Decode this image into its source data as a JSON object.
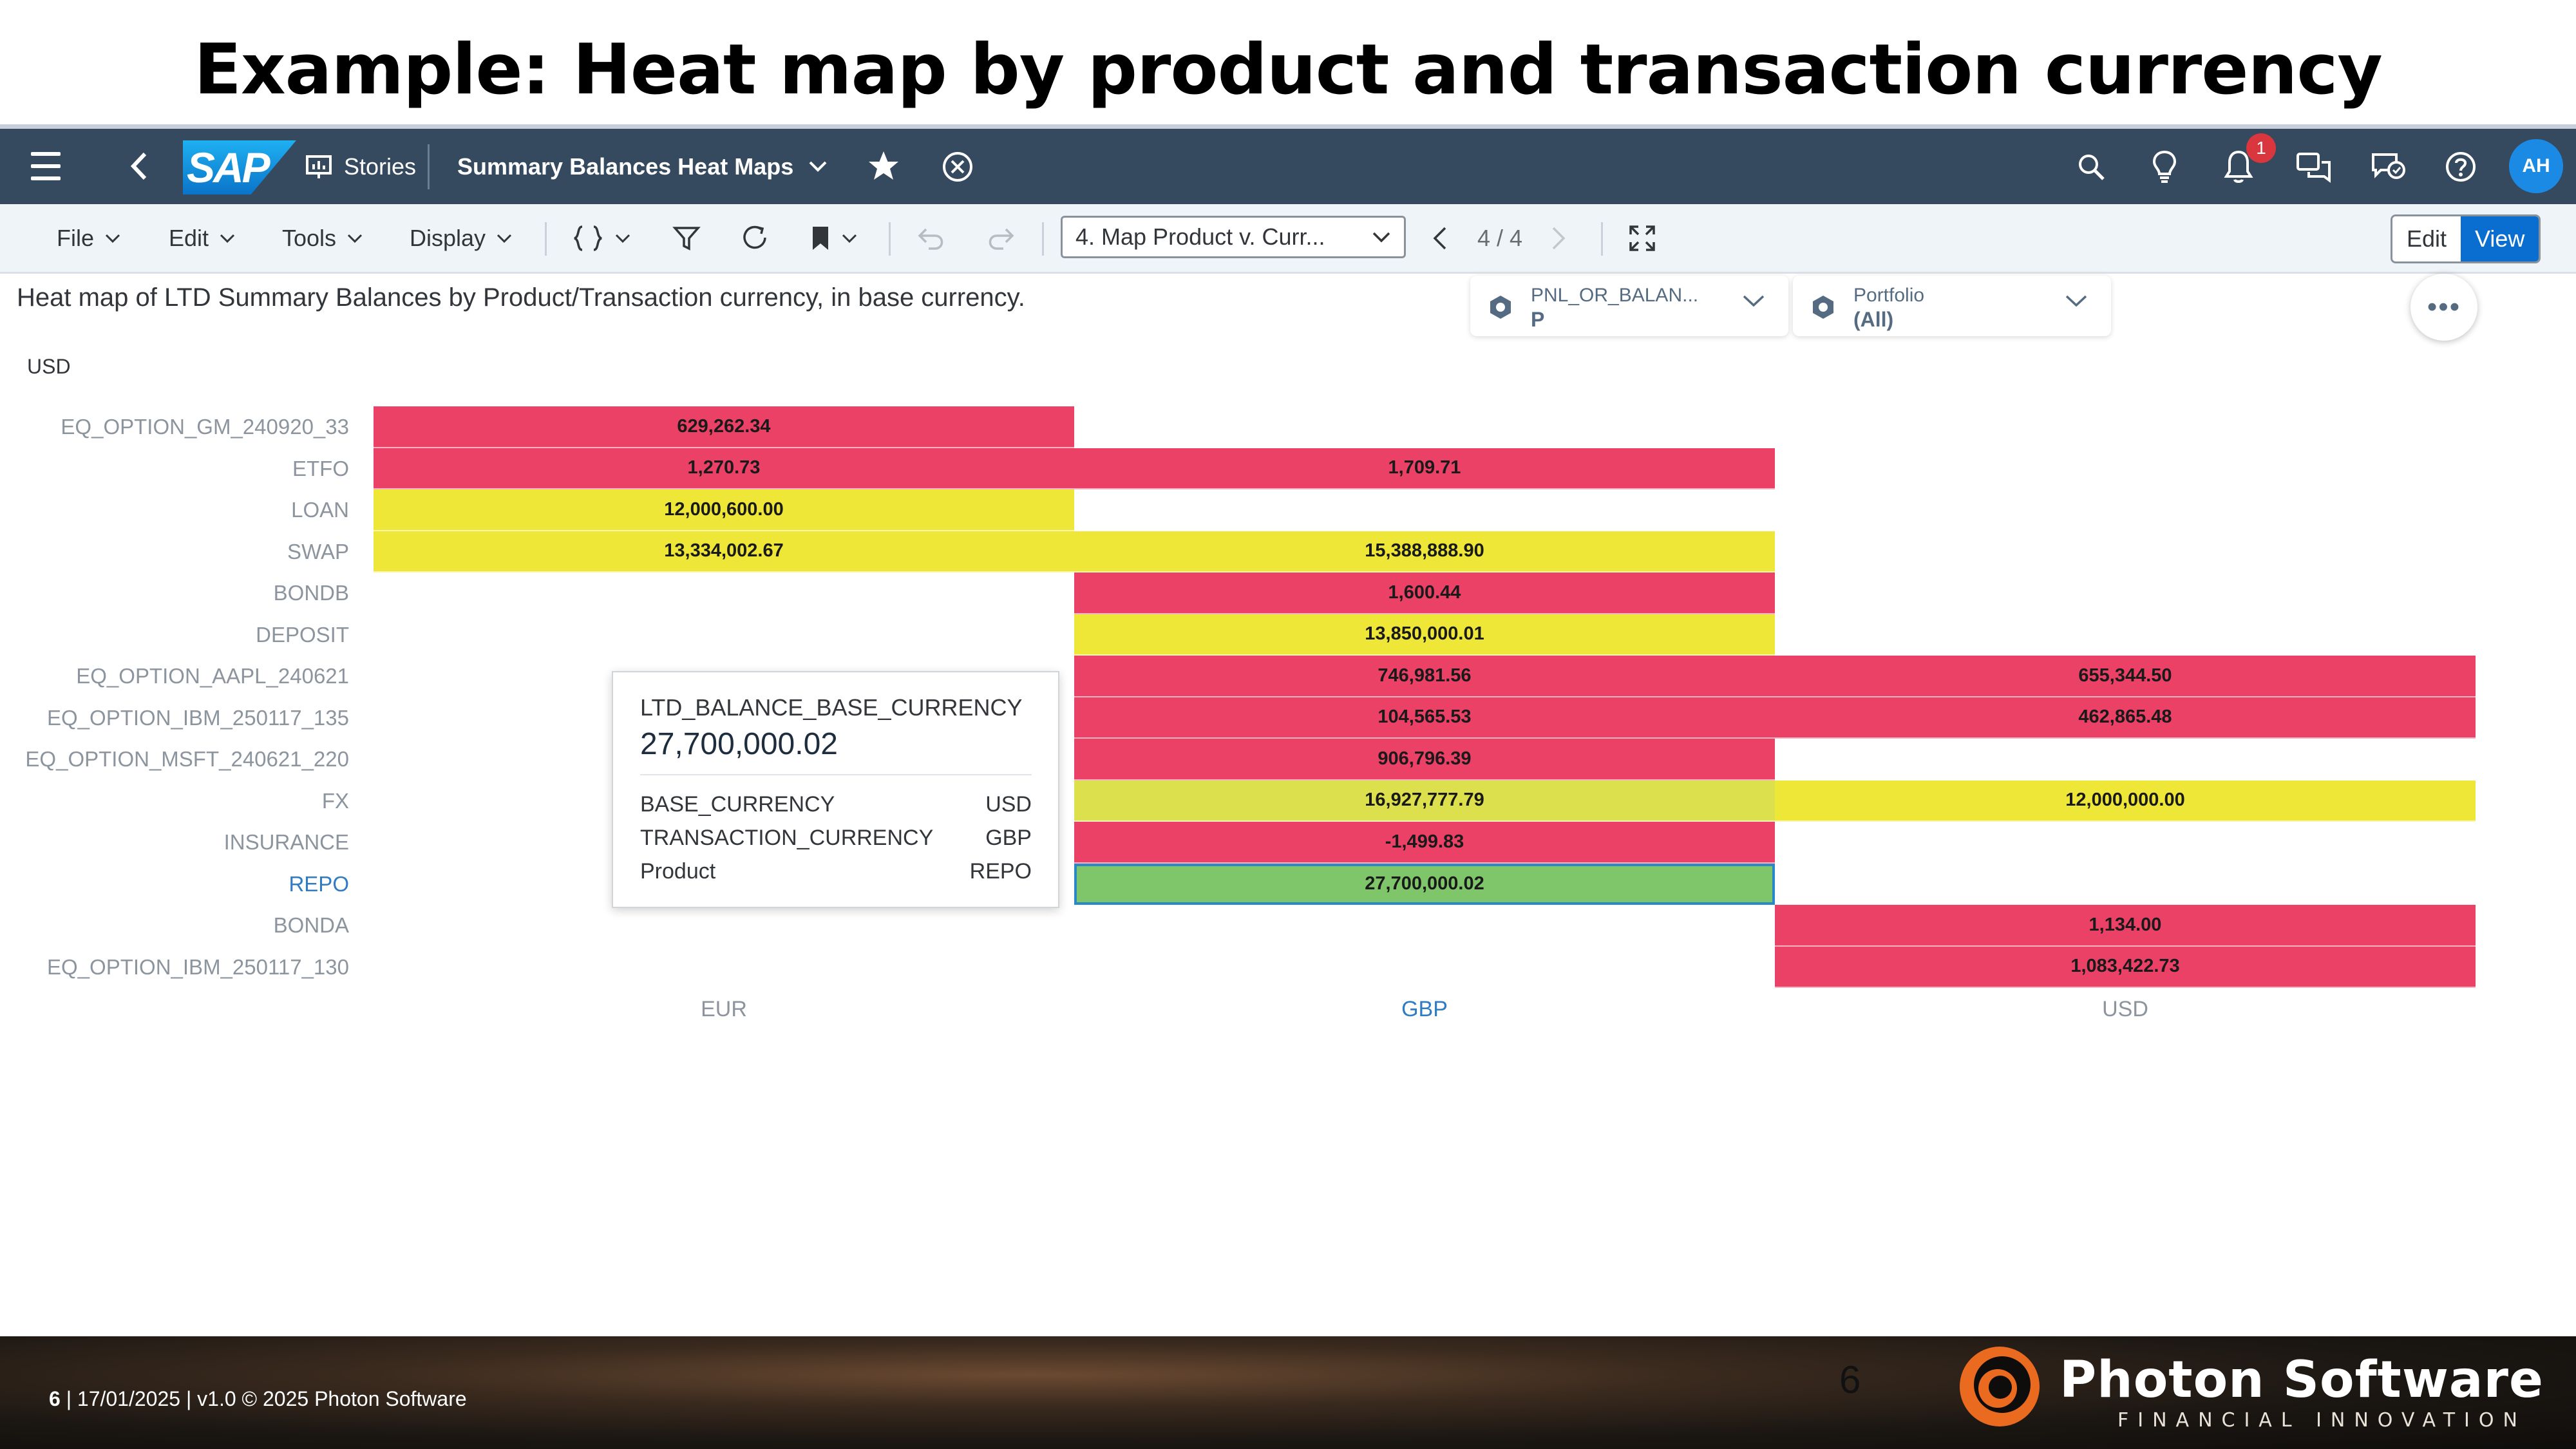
{
  "slide": {
    "title": "Example: Heat map by product and transaction currency"
  },
  "shell": {
    "logo": "SAP",
    "stories_label": "Stories",
    "story_title": "Summary Balances Heat Maps",
    "notification_count": "1",
    "avatar_initials": "AH",
    "icons": [
      "menu-icon",
      "back-icon",
      "stories-icon",
      "chevron-down-icon",
      "star-icon",
      "close-circle-icon",
      "search-icon",
      "lightbulb-icon",
      "bell-icon",
      "chat-icon",
      "feedback-icon",
      "help-icon"
    ]
  },
  "toolbar": {
    "menus": [
      "File",
      "Edit",
      "Tools",
      "Display"
    ],
    "page_select": "4. Map Product v. Curr...",
    "page_counter": "4 / 4",
    "edit_label": "Edit",
    "view_label": "View"
  },
  "content": {
    "description": "Heat map of LTD Summary Balances by Product/Transaction currency, in base currency.",
    "filters": [
      {
        "name": "PNL_OR_BALAN...",
        "value": "P"
      },
      {
        "name": "Portfolio",
        "value": "(All)"
      }
    ],
    "more_label": "•••"
  },
  "colors": {
    "red": "#ec4166",
    "yellow": "#eee737",
    "yellow_green": "#dbe04c",
    "green": "#7fc66b",
    "shell": "#354a5f",
    "accent": "#0a6ed1"
  },
  "chart_data": {
    "type": "heatmap",
    "base_currency_label": "USD",
    "rows": [
      "EQ_OPTION_GM_240920_33",
      "ETFO",
      "LOAN",
      "SWAP",
      "BONDB",
      "DEPOSIT",
      "EQ_OPTION_AAPL_240621",
      "EQ_OPTION_IBM_250117_135",
      "EQ_OPTION_MSFT_240621_220",
      "FX",
      "INSURANCE",
      "REPO",
      "BONDA",
      "EQ_OPTION_IBM_250117_130"
    ],
    "columns": [
      "EUR",
      "GBP",
      "USD"
    ],
    "highlighted_row": "REPO",
    "highlighted_column": "GBP",
    "cells": [
      {
        "row": "EQ_OPTION_GM_240920_33",
        "col": "EUR",
        "value": 629262.34,
        "label": "629,262.34",
        "color": "red"
      },
      {
        "row": "ETFO",
        "col": "EUR",
        "value": 1270.73,
        "label": "1,270.73",
        "color": "red"
      },
      {
        "row": "ETFO",
        "col": "GBP",
        "value": 1709.71,
        "label": "1,709.71",
        "color": "red"
      },
      {
        "row": "LOAN",
        "col": "EUR",
        "value": 12000600.0,
        "label": "12,000,600.00",
        "color": "yellow"
      },
      {
        "row": "SWAP",
        "col": "EUR",
        "value": 13334002.67,
        "label": "13,334,002.67",
        "color": "yellow"
      },
      {
        "row": "SWAP",
        "col": "GBP",
        "value": 15388888.9,
        "label": "15,388,888.90",
        "color": "yellow"
      },
      {
        "row": "BONDB",
        "col": "GBP",
        "value": 1600.44,
        "label": "1,600.44",
        "color": "red"
      },
      {
        "row": "DEPOSIT",
        "col": "GBP",
        "value": 13850000.01,
        "label": "13,850,000.01",
        "color": "yellow"
      },
      {
        "row": "EQ_OPTION_AAPL_240621",
        "col": "GBP",
        "value": 746981.56,
        "label": "746,981.56",
        "color": "red"
      },
      {
        "row": "EQ_OPTION_AAPL_240621",
        "col": "USD",
        "value": 655344.5,
        "label": "655,344.50",
        "color": "red"
      },
      {
        "row": "EQ_OPTION_IBM_250117_135",
        "col": "GBP",
        "value": 104565.53,
        "label": "104,565.53",
        "color": "red"
      },
      {
        "row": "EQ_OPTION_IBM_250117_135",
        "col": "USD",
        "value": 462865.48,
        "label": "462,865.48",
        "color": "red"
      },
      {
        "row": "EQ_OPTION_MSFT_240621_220",
        "col": "GBP",
        "value": 906796.39,
        "label": "906,796.39",
        "color": "red"
      },
      {
        "row": "FX",
        "col": "GBP",
        "value": 16927777.79,
        "label": "16,927,777.79",
        "color": "yellow_green"
      },
      {
        "row": "FX",
        "col": "USD",
        "value": 12000000.0,
        "label": "12,000,000.00",
        "color": "yellow"
      },
      {
        "row": "INSURANCE",
        "col": "GBP",
        "value": -1499.83,
        "label": "-1,499.83",
        "color": "red"
      },
      {
        "row": "REPO",
        "col": "GBP",
        "value": 27700000.02,
        "label": "27,700,000.02",
        "color": "green",
        "selected": true
      },
      {
        "row": "BONDA",
        "col": "USD",
        "value": 1134.0,
        "label": "1,134.00",
        "color": "red"
      },
      {
        "row": "EQ_OPTION_IBM_250117_130",
        "col": "USD",
        "value": 1083422.73,
        "label": "1,083,422.73",
        "color": "red"
      }
    ]
  },
  "tooltip": {
    "measure": "LTD_BALANCE_BASE_CURRENCY",
    "value": "27,700,000.02",
    "rows": [
      {
        "key": "BASE_CURRENCY",
        "value": "USD"
      },
      {
        "key": "TRANSACTION_CURRENCY",
        "value": "GBP"
      },
      {
        "key": "Product",
        "value": "REPO"
      }
    ]
  },
  "footer": {
    "page": "6",
    "text": " |  17/01/2025 | v1.0 © 2025 Photon Software",
    "slide_number": "6",
    "company": "Photon Software",
    "tagline": "FINANCIAL INNOVATION"
  }
}
